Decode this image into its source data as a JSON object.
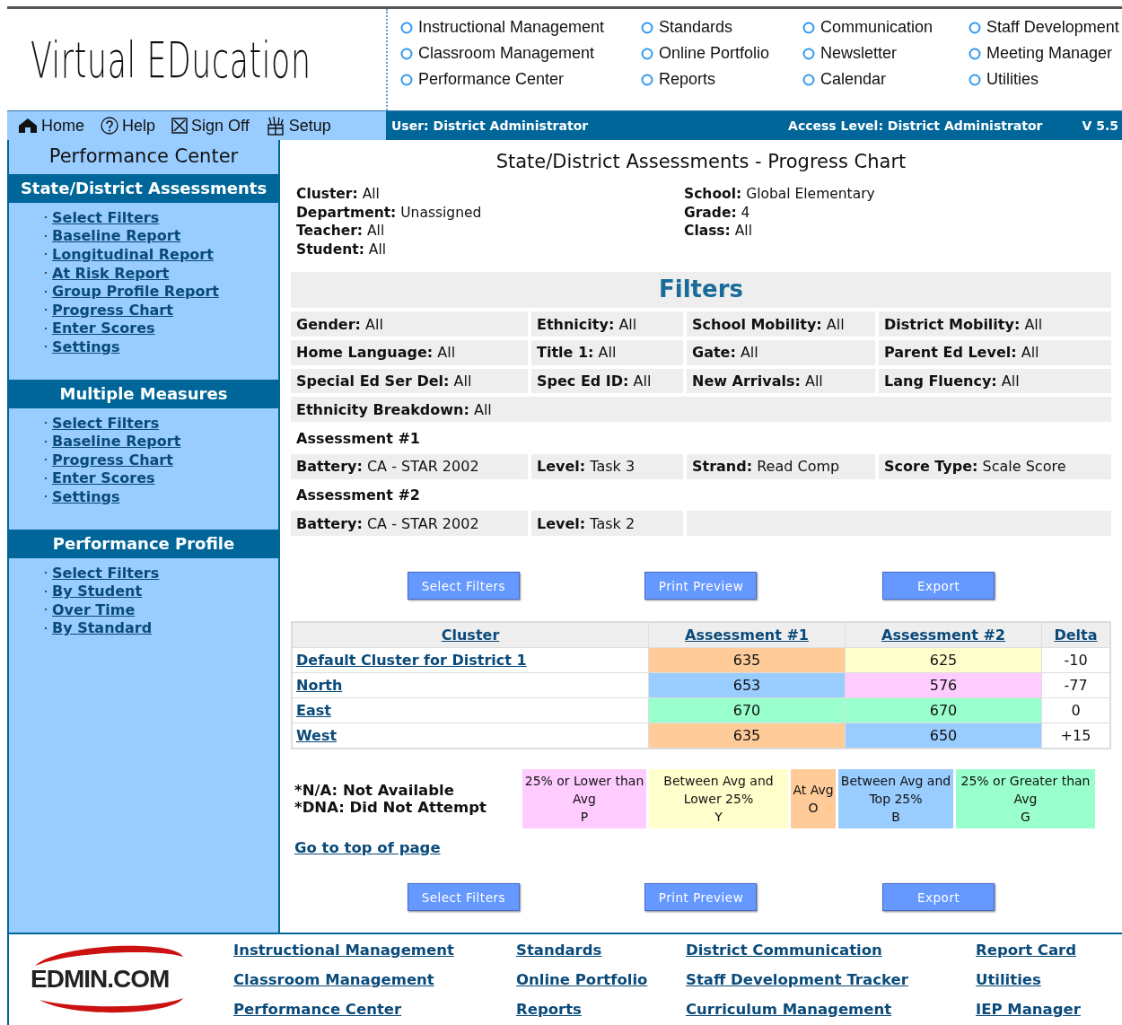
{
  "header": {
    "logo_text": "Virtual EDucation",
    "menu_columns": [
      [
        "Instructional Management",
        "Classroom Management",
        "Performance Center"
      ],
      [
        "Standards",
        "Online Portfolio",
        "Reports"
      ],
      [
        "Communication",
        "Newsletter",
        "Calendar"
      ],
      [
        "Staff Development",
        "Meeting Manager",
        "Utilities"
      ]
    ]
  },
  "toolbar": {
    "items": [
      {
        "kind": "home",
        "label": "Home"
      },
      {
        "kind": "help",
        "label": "Help"
      },
      {
        "kind": "signoff",
        "label": "Sign Off"
      },
      {
        "kind": "setup",
        "label": "Setup"
      }
    ],
    "user": "User: District Administrator",
    "access": "Access Level: District Administrator",
    "version": "V 5.5"
  },
  "sidebar": {
    "title": "Performance Center",
    "sections": [
      {
        "title": "State/District Assessments",
        "links": [
          "Select Filters",
          "Baseline Report",
          "Longitudinal Report",
          "At Risk Report",
          "Group Profile Report",
          "Progress Chart",
          "Enter Scores",
          "Settings"
        ]
      },
      {
        "title": "Multiple Measures",
        "links": [
          "Select Filters",
          "Baseline Report",
          "Progress Chart",
          "Enter Scores",
          "Settings"
        ]
      },
      {
        "title": "Performance Profile",
        "links": [
          "Select Filters",
          "By Student",
          "Over Time",
          "By Standard"
        ]
      }
    ]
  },
  "main": {
    "title": "State/District Assessments - Progress Chart",
    "info_left": [
      {
        "label": "Cluster:",
        "value": "All"
      },
      {
        "label": "Department:",
        "value": "Unassigned"
      },
      {
        "label": "Teacher:",
        "value": "All"
      },
      {
        "label": "Student:",
        "value": "All"
      }
    ],
    "info_right": [
      {
        "label": "School:",
        "value": "Global Elementary"
      },
      {
        "label": "Grade:",
        "value": "4"
      },
      {
        "label": "Class:",
        "value": "All"
      }
    ],
    "filters_title": "Filters",
    "filter_rows": [
      {
        "kind": "cells",
        "cells": [
          {
            "label": "Gender:",
            "value": "All"
          },
          {
            "label": "Ethnicity:",
            "value": "All"
          },
          {
            "label": "School Mobility:",
            "value": "All"
          },
          {
            "label": "District Mobility:",
            "value": "All"
          }
        ]
      },
      {
        "kind": "cells",
        "cells": [
          {
            "label": "Home Language:",
            "value": "All"
          },
          {
            "label": "Title 1:",
            "value": "All"
          },
          {
            "label": "Gate:",
            "value": "All"
          },
          {
            "label": "Parent Ed Level:",
            "value": "All"
          }
        ]
      },
      {
        "kind": "cells",
        "cells": [
          {
            "label": "Special Ed Ser Del:",
            "value": "All"
          },
          {
            "label": "Spec Ed ID:",
            "value": "All"
          },
          {
            "label": "New Arrivals:",
            "value": "All"
          },
          {
            "label": "Lang Fluency:",
            "value": "All"
          }
        ]
      },
      {
        "kind": "wide",
        "cells": [
          {
            "label": "Ethnicity Breakdown:",
            "value": "All"
          }
        ]
      },
      {
        "kind": "heading",
        "text": "Assessment #1"
      },
      {
        "kind": "cells",
        "cells": [
          {
            "label": "Battery:",
            "value": "CA - STAR 2002"
          },
          {
            "label": "Level:",
            "value": "Task 3"
          },
          {
            "label": "Strand:",
            "value": "Read Comp"
          },
          {
            "label": "Score Type:",
            "value": "Scale Score"
          }
        ]
      },
      {
        "kind": "heading",
        "text": "Assessment #2"
      },
      {
        "kind": "cells",
        "cells": [
          {
            "label": "Battery:",
            "value": "CA - STAR 2002"
          },
          {
            "label": "Level:",
            "value": "Task 2"
          }
        ]
      }
    ],
    "buttons_top": [
      "Select Filters",
      "Print Preview",
      "Export"
    ],
    "table": {
      "columns": [
        "Cluster",
        "Assessment #1",
        "Assessment #2",
        "Delta"
      ],
      "rows": [
        {
          "cluster": "Default Cluster for District 1",
          "a1": {
            "value": "635",
            "color": "#ffcc99"
          },
          "a2": {
            "value": "625",
            "color": "#ffffcc"
          },
          "delta": "-10"
        },
        {
          "cluster": "North",
          "a1": {
            "value": "653",
            "color": "#99ccff"
          },
          "a2": {
            "value": "576",
            "color": "#ffccff"
          },
          "delta": "-77"
        },
        {
          "cluster": "East",
          "a1": {
            "value": "670",
            "color": "#99ffcc"
          },
          "a2": {
            "value": "670",
            "color": "#99ffcc"
          },
          "delta": "0"
        },
        {
          "cluster": "West",
          "a1": {
            "value": "635",
            "color": "#ffcc99"
          },
          "a2": {
            "value": "650",
            "color": "#99ccff"
          },
          "delta": "+15"
        }
      ]
    },
    "notes": [
      "*N/A: Not Available",
      "*DNA: Did Not Attempt"
    ],
    "legend": [
      {
        "label": "25% or Lower than Avg",
        "code": "P",
        "color": "#ffccff"
      },
      {
        "label": "Between Avg and Lower 25%",
        "code": "Y",
        "color": "#ffffcc"
      },
      {
        "label": "At Avg",
        "code": "O",
        "color": "#ffcc99"
      },
      {
        "label": "Between Avg and Top 25%",
        "code": "B",
        "color": "#99ccff"
      },
      {
        "label": "25% or Greater than Avg",
        "code": "G",
        "color": "#99ffcc"
      }
    ],
    "top_link": "Go to top of page",
    "buttons_bottom": [
      "Select Filters",
      "Print Preview",
      "Export"
    ]
  },
  "footer": {
    "logo_text": "EDMIN.COM",
    "columns": [
      [
        "Instructional Management",
        "Classroom Management",
        "Performance Center"
      ],
      [
        "Standards",
        "Online Portfolio",
        "Reports"
      ],
      [
        "District Communication",
        "Staff Development Tracker",
        "Curriculum Management"
      ],
      [
        "Report Card",
        "Utilities",
        "IEP Manager"
      ]
    ]
  }
}
